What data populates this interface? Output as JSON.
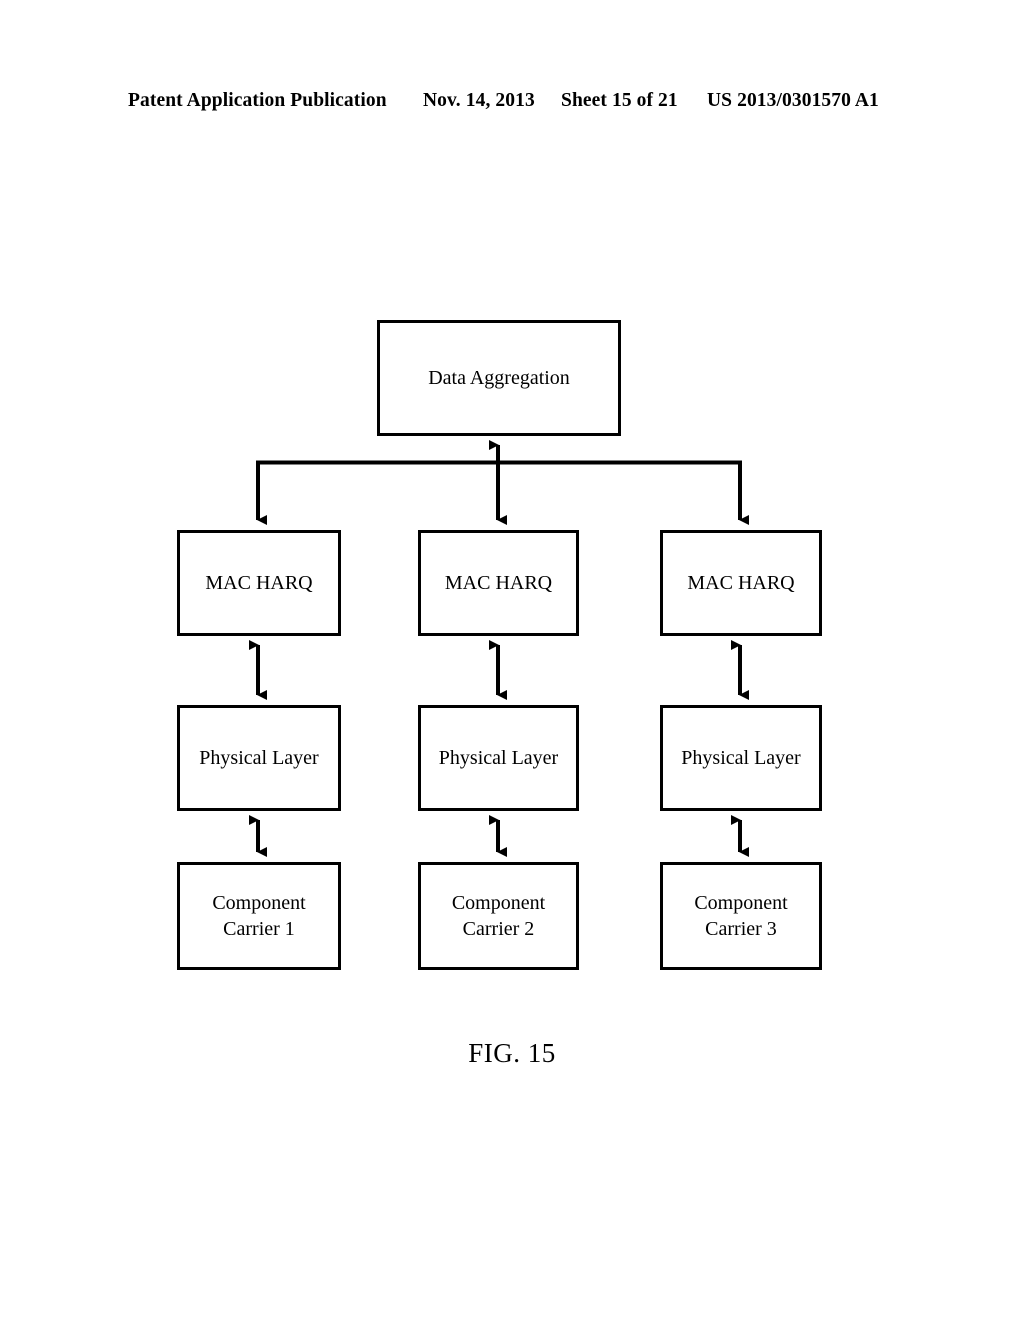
{
  "header": {
    "publication": "Patent Application Publication",
    "date": "Nov. 14, 2013",
    "sheet": "Sheet 15 of 21",
    "patent_number": "US 2013/0301570 A1"
  },
  "figure": {
    "caption": "FIG. 15",
    "stroke_color": "#000000",
    "fill_color": "#ffffff",
    "top_node": {
      "label": "Data Aggregation"
    },
    "columns": [
      {
        "mac_label": "MAC HARQ",
        "phy_label": "Physical Layer",
        "cc_label_line1": "Component",
        "cc_label_line2": "Carrier 1"
      },
      {
        "mac_label": "MAC HARQ",
        "phy_label": "Physical Layer",
        "cc_label_line1": "Component",
        "cc_label_line2": "Carrier 2"
      },
      {
        "mac_label": "MAC HARQ",
        "phy_label": "Physical Layer",
        "cc_label_line1": "Component",
        "cc_label_line2": "Carrier 3"
      }
    ],
    "connectors": {
      "bus_to_left": "arrow-down",
      "bus_to_middle": "arrow-double-vertical",
      "bus_to_right": "arrow-down",
      "mac_to_phy": "arrow-double-vertical",
      "phy_to_cc": "arrow-double-vertical"
    }
  }
}
